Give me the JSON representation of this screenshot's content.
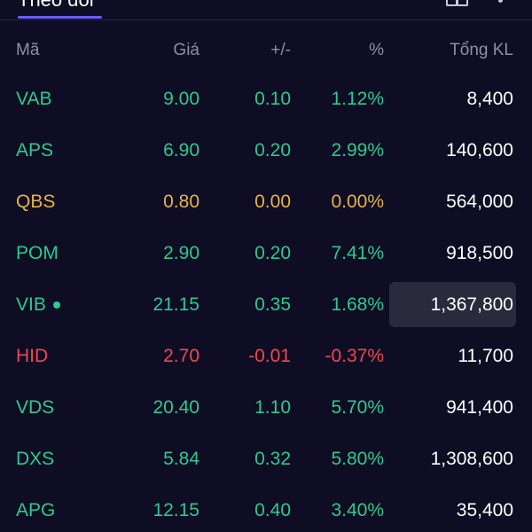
{
  "tabs": {
    "active_label": "Theo dõi"
  },
  "colors": {
    "up": "#2ec98e",
    "ref": "#e6b34a",
    "down": "#f0474f",
    "accent": "#6a5cff",
    "background": "#0e0d24"
  },
  "icons": [
    "grid-view-icon",
    "more-vertical-icon",
    "status-dot-icon"
  ],
  "table": {
    "headers": {
      "code": "Mã",
      "price": "Giá",
      "change": "+/-",
      "percent": "%",
      "volume": "Tổng KL"
    },
    "rows": [
      {
        "code": "VAB",
        "price": "9.00",
        "change": "0.10",
        "percent": "1.12%",
        "volume": "8,400",
        "status": "up",
        "dot": false,
        "highlight": false
      },
      {
        "code": "APS",
        "price": "6.90",
        "change": "0.20",
        "percent": "2.99%",
        "volume": "140,600",
        "status": "up",
        "dot": false,
        "highlight": false
      },
      {
        "code": "QBS",
        "price": "0.80",
        "change": "0.00",
        "percent": "0.00%",
        "volume": "564,000",
        "status": "ref",
        "dot": false,
        "highlight": false
      },
      {
        "code": "POM",
        "price": "2.90",
        "change": "0.20",
        "percent": "7.41%",
        "volume": "918,500",
        "status": "up",
        "dot": false,
        "highlight": false
      },
      {
        "code": "VIB",
        "price": "21.15",
        "change": "0.35",
        "percent": "1.68%",
        "volume": "1,367,800",
        "status": "up",
        "dot": true,
        "highlight": true
      },
      {
        "code": "HID",
        "price": "2.70",
        "change": "-0.01",
        "percent": "-0.37%",
        "volume": "11,700",
        "status": "down",
        "dot": false,
        "highlight": false
      },
      {
        "code": "VDS",
        "price": "20.40",
        "change": "1.10",
        "percent": "5.70%",
        "volume": "941,400",
        "status": "up",
        "dot": false,
        "highlight": false
      },
      {
        "code": "DXS",
        "price": "5.84",
        "change": "0.32",
        "percent": "5.80%",
        "volume": "1,308,600",
        "status": "up",
        "dot": false,
        "highlight": false
      },
      {
        "code": "APG",
        "price": "12.15",
        "change": "0.40",
        "percent": "3.40%",
        "volume": "35,400",
        "status": "up",
        "dot": false,
        "highlight": false
      }
    ]
  }
}
